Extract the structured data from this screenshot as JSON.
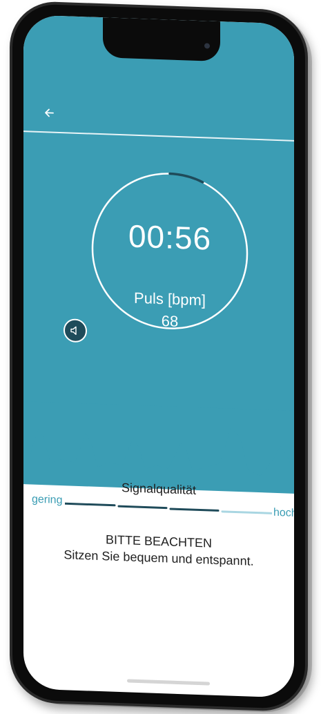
{
  "colors": {
    "teal": "#3b9db4",
    "dark_teal": "#1f4b5a",
    "text_dark": "#1e1e1e",
    "white": "#ffffff"
  },
  "header": {
    "back_icon": "arrow-left-icon"
  },
  "measurement": {
    "timer": "00:56",
    "progress_fraction": 0.07,
    "pulse_label": "Puls [bpm]",
    "pulse_value": "68"
  },
  "sound": {
    "icon": "speaker-icon"
  },
  "signal_quality": {
    "title": "Signalqualität",
    "low_label": "gering",
    "high_label": "hoch",
    "filled_segments": 3,
    "total_segments": 4
  },
  "notice": {
    "title": "BITTE BEACHTEN",
    "text": "Sitzen Sie bequem und entspannt."
  }
}
